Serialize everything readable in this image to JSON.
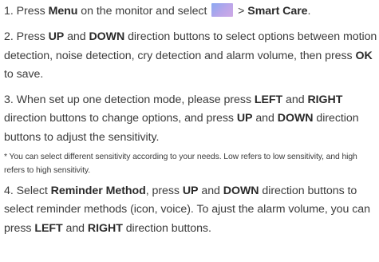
{
  "steps": [
    {
      "number": "1.",
      "text_1": "Press ",
      "bold_1": "Menu",
      "text_2": " on the monitor and select ",
      "icon": "smart-care-menu-icon",
      "text_3": " > ",
      "bold_2": "Smart Care",
      "text_4": "."
    },
    {
      "number": "2.",
      "text_1": "Press ",
      "bold_1": "UP",
      "text_2": " and ",
      "bold_2": "DOWN",
      "text_3": " direction buttons to select options between motion detection, noise detection, cry detection and alarm volume, then press ",
      "bold_3": "OK",
      "text_4": " to save."
    },
    {
      "number": "3.",
      "text_1": "When set up one detection mode, please press ",
      "bold_1": "LEFT",
      "text_2": " and ",
      "bold_2": "RIGHT",
      "text_3": " direction buttons to change options, and press ",
      "bold_3": "UP",
      "text_4": " and ",
      "bold_4": "DOWN",
      "text_5": " direction buttons to adjust the sensitivity."
    }
  ],
  "note": "* You can select different sensitivity according to your needs. Low refers to low sensitivity, and high refers to high sensitivity.",
  "step4": {
    "number": "4.",
    "text_1": "Select ",
    "bold_1": "Reminder Method",
    "text_2": ", press ",
    "bold_2": "UP",
    "text_3": " and ",
    "bold_3": "DOWN",
    "text_4": " direction buttons to select reminder methods (icon, voice). To ajust the alarm volume, you can press ",
    "bold_4": "LEFT",
    "text_5": " and ",
    "bold_5": "RIGHT",
    "text_6": " direction buttons."
  },
  "colors": {
    "text": "#3c3c3c",
    "icon_gradient_start": "#8aa8f2",
    "icon_gradient_end": "#cfa9e6"
  }
}
